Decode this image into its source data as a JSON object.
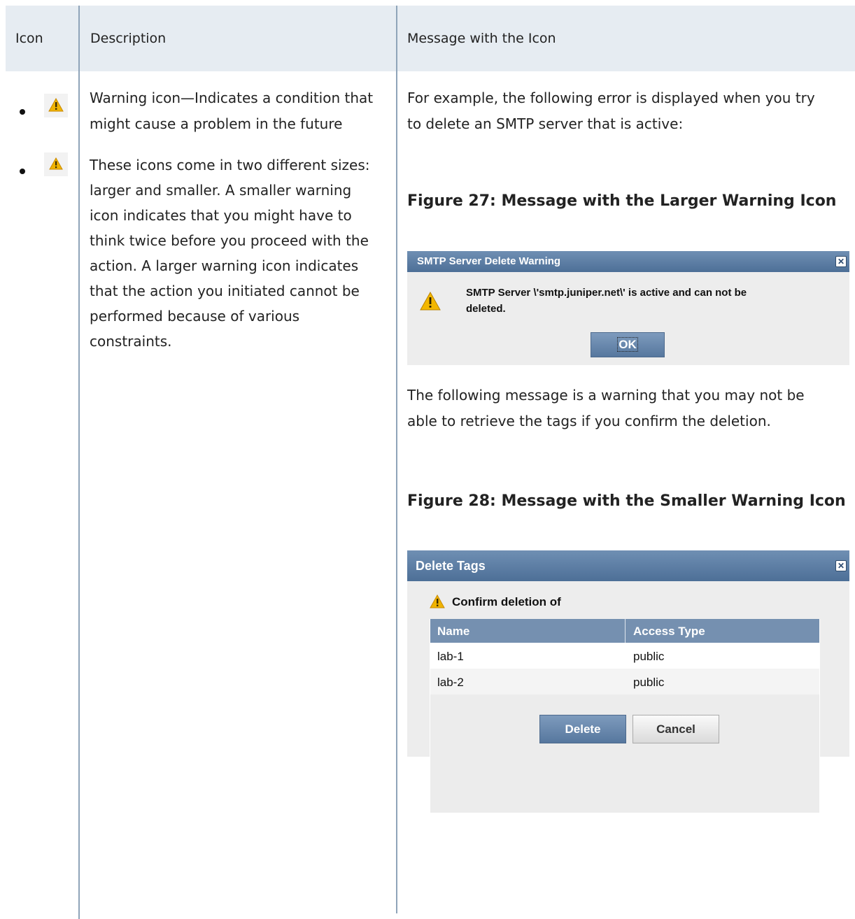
{
  "table": {
    "headers": {
      "icon": "Icon",
      "description": "Description",
      "message": "Message with the Icon"
    },
    "description": {
      "line1": "Warning icon—Indicates a condition that",
      "line2": "might cause a problem in the future",
      "p2": [
        "These icons come in two different sizes:",
        "larger and smaller. A smaller warning",
        "icon indicates that you might have to",
        "think twice before you proceed with the",
        "action. A larger warning icon indicates",
        "that the action you initiated cannot be",
        "performed because of various",
        "constraints."
      ]
    },
    "message": {
      "intro": [
        "For example, the following error is displayed when you try",
        "to delete an SMTP server that is active:"
      ],
      "fig27_title": "Figure 27: Message with the Larger Warning Icon",
      "between": [
        "The following message is a warning that you may not be",
        "able to retrieve the tags if you confirm the deletion."
      ],
      "fig28_title": "Figure 28: Message with the Smaller Warning Icon"
    }
  },
  "dialog1": {
    "title": "SMTP Server Delete Warning",
    "message_line1": "SMTP Server \\'smtp.juniper.net\\' is active and can not be",
    "message_line2": "deleted.",
    "ok_label": "OK",
    "icon": "warning-icon"
  },
  "dialog2": {
    "title": "Delete Tags",
    "confirm_text": "Confirm deletion of",
    "columns": [
      "Name",
      "Access Type"
    ],
    "rows": [
      {
        "name": "lab-1",
        "access": "public"
      },
      {
        "name": "lab-2",
        "access": "public"
      }
    ],
    "delete_label": "Delete",
    "cancel_label": "Cancel"
  },
  "colors": {
    "header_bg": "#e6ecf2",
    "dialog_title": "#56779e",
    "warning": "#f0b400"
  }
}
